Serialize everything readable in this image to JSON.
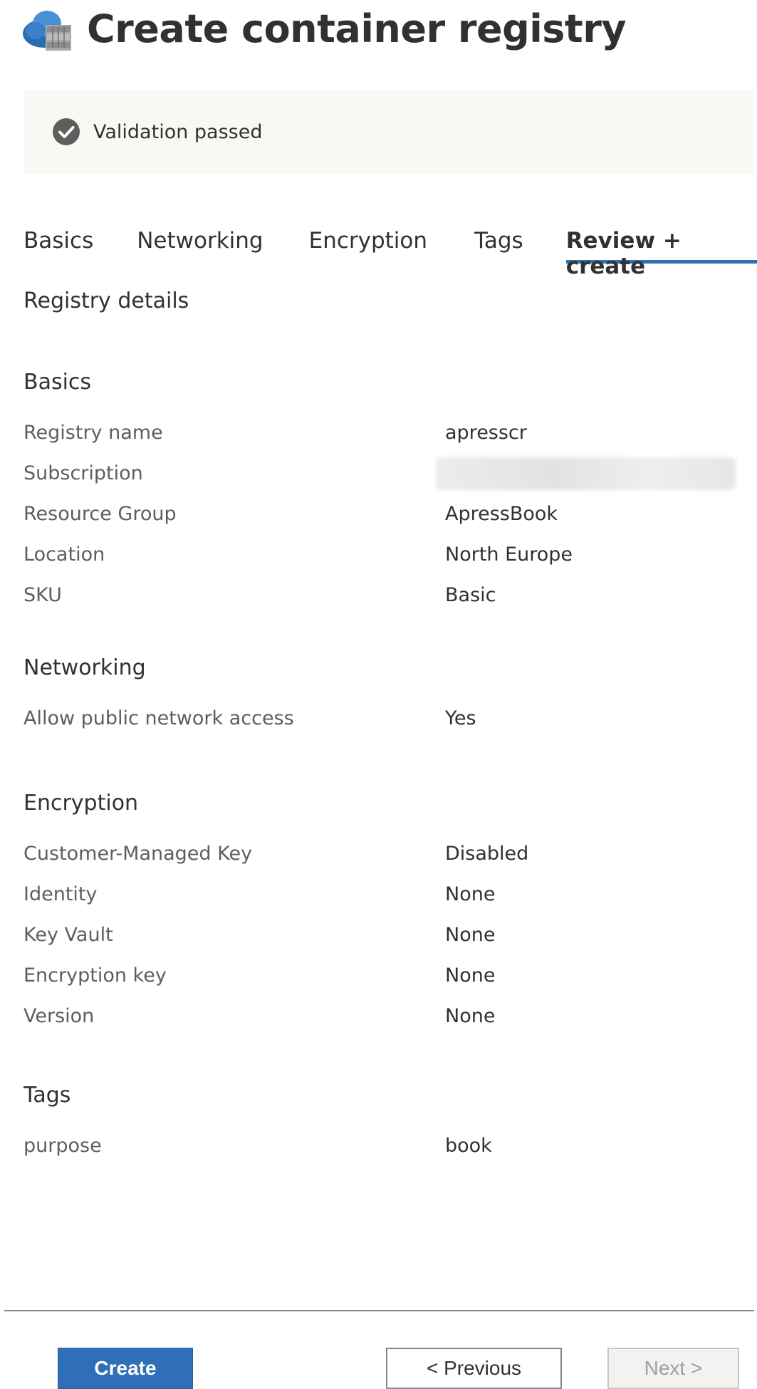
{
  "header": {
    "title": "Create container registry",
    "icon": "container-registry-icon"
  },
  "banner": {
    "message": "Validation passed",
    "icon": "check-circle-icon",
    "color": "#605e5c"
  },
  "tabs": [
    {
      "label": "Basics",
      "active": false
    },
    {
      "label": "Networking",
      "active": false
    },
    {
      "label": "Encryption",
      "active": false
    },
    {
      "label": "Tags",
      "active": false
    },
    {
      "label": "Review + create",
      "active": true
    }
  ],
  "details": {
    "title": "Registry details",
    "basics": {
      "title": "Basics",
      "rows": [
        {
          "label": "Registry name",
          "value": "apresscr"
        },
        {
          "label": "Subscription",
          "value": ""
        },
        {
          "label": "Resource Group",
          "value": "ApressBook"
        },
        {
          "label": "Location",
          "value": "North Europe"
        },
        {
          "label": "SKU",
          "value": "Basic"
        }
      ]
    },
    "networking": {
      "title": "Networking",
      "rows": [
        {
          "label": "Allow public network access",
          "value": "Yes"
        }
      ]
    },
    "encryption": {
      "title": "Encryption",
      "rows": [
        {
          "label": "Customer-Managed Key",
          "value": "Disabled"
        },
        {
          "label": "Identity",
          "value": "None"
        },
        {
          "label": "Key Vault",
          "value": "None"
        },
        {
          "label": "Encryption key",
          "value": "None"
        },
        {
          "label": "Version",
          "value": "None"
        }
      ]
    },
    "tags": {
      "title": "Tags",
      "rows": [
        {
          "label": "purpose",
          "value": "book"
        }
      ]
    }
  },
  "footer": {
    "create_label": "Create",
    "previous_label": "< Previous",
    "next_label": "Next >"
  },
  "colors": {
    "accent": "#2f6fb7",
    "banner_bg": "#f8f8f4"
  }
}
